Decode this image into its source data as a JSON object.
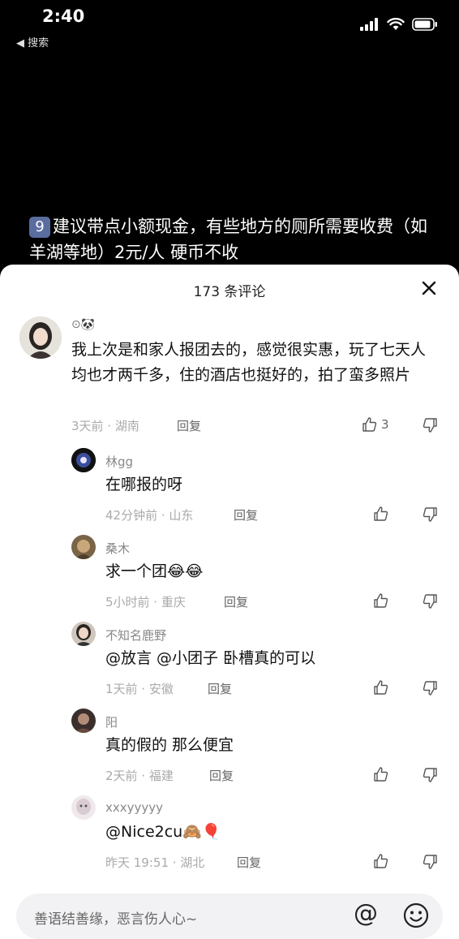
{
  "status": {
    "time": "2:40",
    "back_label": "◀ 搜索"
  },
  "caption": {
    "number": "9",
    "text": "建议带点小额现金，有些地方的厕所需要收费（如羊湖等地）2元/人 硬币不收"
  },
  "sheet": {
    "title": "173 条评论"
  },
  "main_comment": {
    "name": "",
    "text": "我上次是和家人报团去的，感觉很实惠，玩了七天人均也才两千多，住的酒店也挺好的，拍了蛮多照片",
    "meta": "3天前 · 湖南",
    "reply_label": "回复",
    "like_count": "3"
  },
  "replies": [
    {
      "name": "林gg",
      "text": "在哪报的呀",
      "meta": "42分钟前 · 山东",
      "reply_label": "回复"
    },
    {
      "name": "桑木",
      "text": "求一个团😂😂",
      "meta": "5小时前 · 重庆",
      "reply_label": "回复"
    },
    {
      "name": "不知名鹿野",
      "text": "@放言 @小团子 卧槽真的可以",
      "meta": "1天前 · 安徽",
      "reply_label": "回复"
    },
    {
      "name": "阳",
      "text": "真的假的 那么便宜",
      "meta": "2天前 · 福建",
      "reply_label": "回复"
    },
    {
      "name": "xxxyyyyy",
      "text": "@Nice2cu🙈🎈",
      "meta": "昨天 19:51 · 湖北",
      "reply_label": "回复"
    }
  ],
  "input": {
    "placeholder": "善语结善缘，恶言伤人心~",
    "at_label": "@"
  }
}
